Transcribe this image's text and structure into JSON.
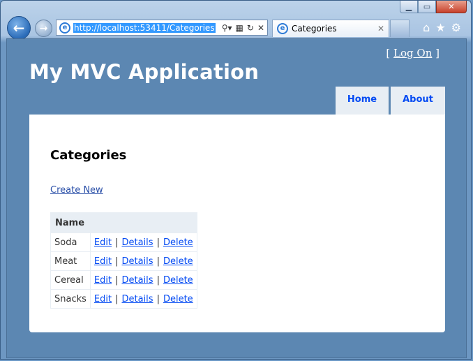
{
  "browser": {
    "url": "http://localhost:53411/Categories",
    "tab_title": "Categories",
    "tab_close": "✕",
    "window_controls": {
      "minimize": "▁",
      "maximize": "▭",
      "close": "✕"
    }
  },
  "site": {
    "title": "My MVC Application",
    "logon_prefix": "[ ",
    "logon_label": "Log On",
    "logon_suffix": " ]",
    "menu": [
      {
        "label": "Home"
      },
      {
        "label": "About"
      }
    ]
  },
  "page": {
    "heading": "Categories",
    "create_new": "Create New",
    "table": {
      "header": "Name",
      "actions": {
        "edit": "Edit",
        "details": "Details",
        "delete": "Delete",
        "separator": "|"
      },
      "rows": [
        {
          "name": "Soda"
        },
        {
          "name": "Meat"
        },
        {
          "name": "Cereal"
        },
        {
          "name": "Snacks"
        }
      ]
    }
  },
  "colors": {
    "page_background": "#5c87b2",
    "link": "#034af3",
    "menu_tab": "#e8eef4"
  },
  "icons": {
    "back": "back-arrow-icon",
    "forward": "forward-arrow-icon",
    "ie": "internet-explorer-icon",
    "search": "search-icon",
    "refresh": "refresh-icon",
    "stop": "stop-icon",
    "home": "home-icon",
    "favorites": "star-icon",
    "tools": "gear-icon"
  }
}
